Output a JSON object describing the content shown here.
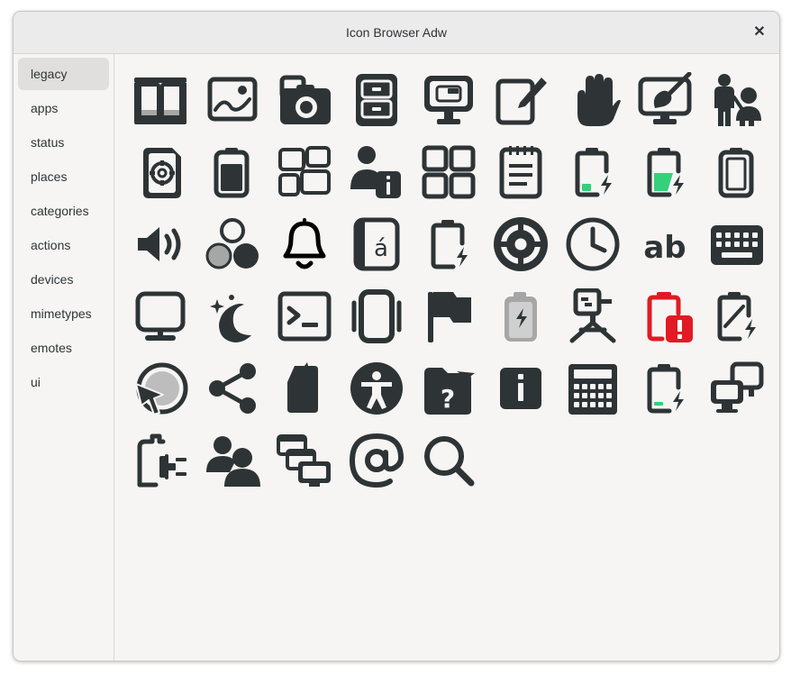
{
  "window": {
    "title": "Icon Browser Adw",
    "close_glyph": "✕"
  },
  "sidebar": {
    "items": [
      {
        "label": "legacy",
        "selected": true
      },
      {
        "label": "apps"
      },
      {
        "label": "status"
      },
      {
        "label": "places"
      },
      {
        "label": "categories"
      },
      {
        "label": "actions"
      },
      {
        "label": "devices"
      },
      {
        "label": "mimetypes"
      },
      {
        "label": "emotes"
      },
      {
        "label": "ui"
      }
    ]
  },
  "colors": {
    "icon": "#2e3436",
    "battery_green": "#33d17a",
    "alert_red": "#e01b24",
    "muted_gray": "#a6a6a6"
  },
  "icons": [
    "book-open-icon",
    "image-icon",
    "camera-photo-icon",
    "file-cabinet-icon",
    "computer-display-icon",
    "document-edit-icon",
    "hand-stop-icon",
    "display-draw-icon",
    "people-child-icon",
    "document-safe-icon",
    "battery-full-icon",
    "view-grid-alt-icon",
    "person-info-icon",
    "view-grid-icon",
    "notepad-icon",
    "battery-charging-low-icon",
    "battery-charging-green-icon",
    "battery-empty-icon",
    "audio-volume-icon",
    "color-circles-icon",
    "bell-icon",
    "accent-char-icon",
    "battery-charging-empty-icon",
    "lifebuoy-help-icon",
    "clock-icon",
    "spell-check-icon",
    "keyboard-icon",
    "monitor-icon",
    "night-mode-icon",
    "terminal-icon",
    "phone-vibrate-icon",
    "flag-icon",
    "battery-charging-gray-icon",
    "webcam-icon",
    "battery-alert-red-icon",
    "battery-charging-alt-icon",
    "globe-pointer-icon",
    "share-icon",
    "sd-card-icon",
    "accessibility-icon",
    "folder-help-icon",
    "info-square-icon",
    "calculator-icon",
    "battery-charging-low-alt-icon",
    "network-computers-icon",
    "ac-adapter-icon",
    "users-icon",
    "network-transfer-icon",
    "at-sign-icon",
    "search-icon"
  ]
}
